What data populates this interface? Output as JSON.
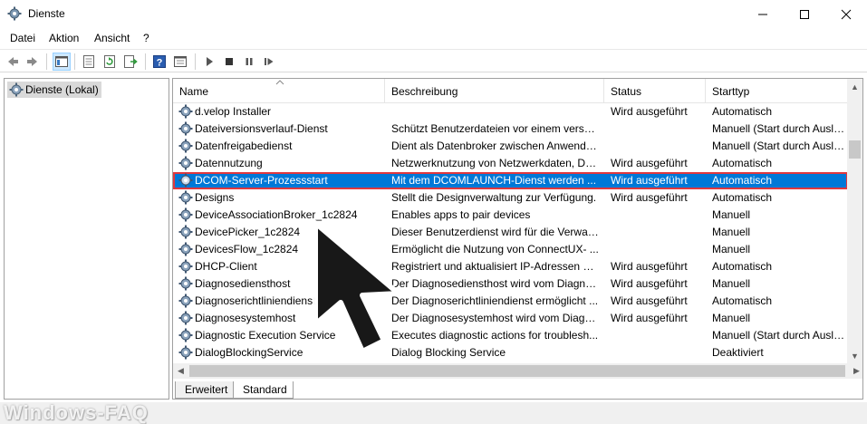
{
  "window": {
    "title": "Dienste",
    "icon": "gear-icon"
  },
  "menu": [
    "Datei",
    "Aktion",
    "Ansicht",
    "?"
  ],
  "toolbar": {
    "icons": [
      "back-arrow-icon",
      "forward-arrow-icon",
      "show-tree-icon",
      "properties-icon",
      "refresh-icon",
      "export-icon",
      "help-icon",
      "view-icon",
      "start-service-icon",
      "stop-service-icon",
      "pause-service-icon",
      "restart-service-icon"
    ]
  },
  "tree": {
    "root_label": "Dienste (Lokal)"
  },
  "table": {
    "columns": [
      "Name",
      "Beschreibung",
      "Status",
      "Starttyp"
    ],
    "rows": [
      {
        "name": "d.velop Installer",
        "desc": "",
        "status": "Wird ausgeführt",
        "start": "Automatisch"
      },
      {
        "name": "Dateiversionsverlauf-Dienst",
        "desc": "Schützt Benutzerdateien vor einem verseh...",
        "status": "",
        "start": "Manuell (Start durch Auslösе"
      },
      {
        "name": "Datenfreigabedienst",
        "desc": "Dient als Datenbroker zwischen Anwendu...",
        "status": "",
        "start": "Manuell (Start durch Auslöse"
      },
      {
        "name": "Datennutzung",
        "desc": "Netzwerknutzung von Netzwerkdaten, Datenlimit, ...",
        "status": "Wird ausgeführt",
        "start": "Automatisch"
      },
      {
        "name": "DCOM-Server-Prozessstart",
        "desc": "Mit dem DCOMLAUNCH-Dienst werden ...",
        "status": "Wird ausgeführt",
        "start": "Automatisch",
        "selected": true
      },
      {
        "name": "Designs",
        "desc": "Stellt die Designverwaltung zur Verfügung.",
        "status": "Wird ausgeführt",
        "start": "Automatisch"
      },
      {
        "name": "DeviceAssociationBroker_1c2824",
        "desc": "Enables apps to pair devices",
        "status": "",
        "start": "Manuell"
      },
      {
        "name": "DevicePicker_1c2824",
        "desc": "Dieser Benutzerdienst wird für die Verwalt...",
        "status": "",
        "start": "Manuell"
      },
      {
        "name": "DevicesFlow_1c2824",
        "desc": "Ermöglicht die Nutzung von ConnectUX- ...",
        "status": "",
        "start": "Manuell"
      },
      {
        "name": "DHCP-Client",
        "desc": "Registriert und aktualisiert IP-Adressen un...",
        "status": "Wird ausgeführt",
        "start": "Automatisch"
      },
      {
        "name": "Diagnosediensthost",
        "desc": "Der Diagnosediensthost wird vom Diagno...",
        "status": "Wird ausgeführt",
        "start": "Manuell"
      },
      {
        "name": "Diagnoserichtliniendienst",
        "desc": "Der Diagnoserichtliniendienst ermöglicht ...",
        "status": "Wird ausgeführt",
        "start": "Automatisch"
      },
      {
        "name": "Diagnosesystemhost",
        "desc": "Der Diagnosesystemhost wird vom Diagno...",
        "status": "Wird ausgeführt",
        "start": "Manuell"
      },
      {
        "name": "Diagnostic Execution Service",
        "desc": "Executes diagnostic actions for troublesh...",
        "status": "",
        "start": "Manuell (Start durch Auslöse"
      },
      {
        "name": "DialogBlockingService",
        "desc": "Dialog Blocking Service",
        "status": "",
        "start": "Deaktiviert"
      }
    ]
  },
  "tabs": [
    "Erweitert",
    "Standard"
  ],
  "watermark": "Windows-FAQ",
  "colors": {
    "selection": "#0078d7",
    "highlight_border": "#e0383e"
  }
}
